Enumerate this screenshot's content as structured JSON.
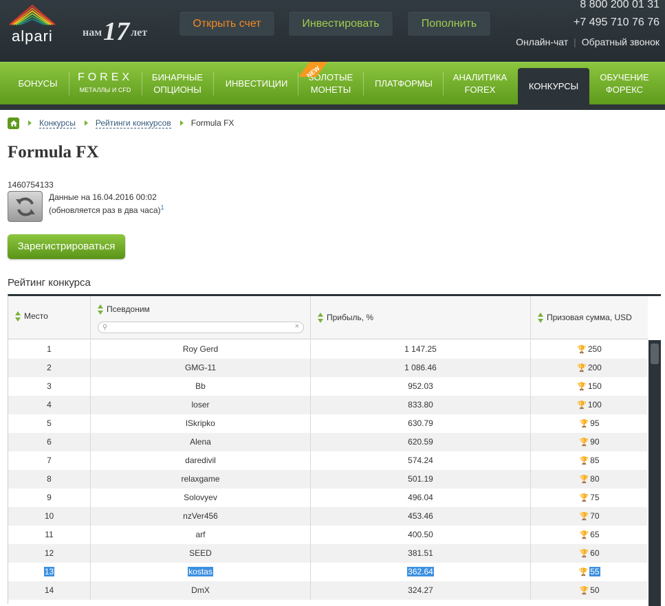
{
  "header": {
    "logo_text": "alpari",
    "years_prefix": "нам",
    "years_num": "17",
    "years_suffix": "лет",
    "btn_open": "Открыть счет",
    "btn_invest": "Инвестировать",
    "btn_topup": "Пополнить",
    "phone1": "8 800 200 01 31",
    "phone2": "+7 495 710 76 76",
    "chat": "Онлайн-чат",
    "callback": "Обратный звонок"
  },
  "nav": {
    "bonuses": "БОНУСЫ",
    "forex_big": "FOREX",
    "forex_small": "МЕТАЛЛЫ И CFD",
    "binary1": "БИНАРНЫЕ",
    "binary2": "ОПЦИОНЫ",
    "invest": "ИНВЕСТИЦИИ",
    "new_badge": "NEW",
    "gold1": "ЗОЛОТЫЕ",
    "gold2": "МОНЕТЫ",
    "platforms": "ПЛАТФОРМЫ",
    "analytics1": "АНАЛИТИКА",
    "analytics2": "FOREX",
    "contests": "КОНКУРСЫ",
    "edu1": "ОБУЧЕНИЕ",
    "edu2": "ФОРЕКС"
  },
  "breadcrumb": {
    "item1": "Конкурсы",
    "item2": "Рейтинги конкурсов",
    "current": "Formula FX"
  },
  "page": {
    "title": "Formula FX",
    "timestamp": "1460754133",
    "data_date": "Данные на 16.04.2016 00:02",
    "update_note": "(обновляется раз в два часа)",
    "footnote": "1",
    "register": "Зарегистрироваться",
    "rating_heading": "Рейтинг конкурса"
  },
  "table": {
    "headers": {
      "place": "Место",
      "nickname": "Псевдоним",
      "profit": "Прибыль, %",
      "prize": "Призовая сумма, USD"
    },
    "rows": [
      {
        "place": "1",
        "nick": "Roy Gerd",
        "profit": "1 147.25",
        "prize": "250"
      },
      {
        "place": "2",
        "nick": "GMG-11",
        "profit": "1 086.46",
        "prize": "200"
      },
      {
        "place": "3",
        "nick": "Bb",
        "profit": "952.03",
        "prize": "150"
      },
      {
        "place": "4",
        "nick": "loser",
        "profit": "833.80",
        "prize": "100"
      },
      {
        "place": "5",
        "nick": "lSkripko",
        "profit": "630.79",
        "prize": "95"
      },
      {
        "place": "6",
        "nick": "Alena",
        "profit": "620.59",
        "prize": "90"
      },
      {
        "place": "7",
        "nick": "daredivil",
        "profit": "574.24",
        "prize": "85"
      },
      {
        "place": "8",
        "nick": "relaxgame",
        "profit": "501.19",
        "prize": "80"
      },
      {
        "place": "9",
        "nick": "Solovyev",
        "profit": "496.04",
        "prize": "75"
      },
      {
        "place": "10",
        "nick": "nzVer456",
        "profit": "453.46",
        "prize": "70"
      },
      {
        "place": "11",
        "nick": "arf",
        "profit": "400.50",
        "prize": "65"
      },
      {
        "place": "12",
        "nick": "SEED",
        "profit": "381.51",
        "prize": "60"
      },
      {
        "place": "13",
        "nick": "kostas",
        "profit": "362.64",
        "prize": "55"
      },
      {
        "place": "14",
        "nick": "DmX",
        "profit": "324.27",
        "prize": "50"
      }
    ]
  }
}
